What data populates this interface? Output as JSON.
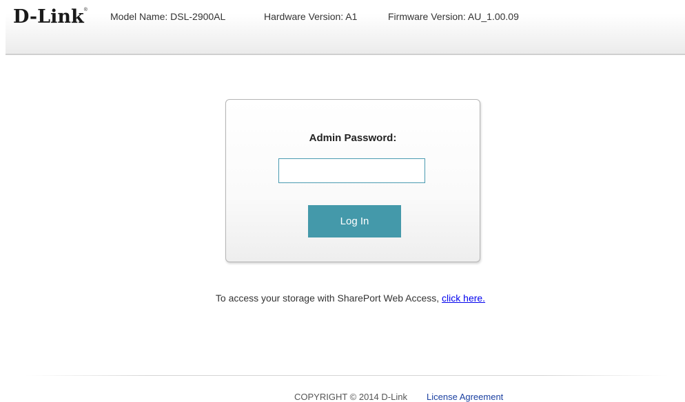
{
  "header": {
    "logo_text": "D-Link",
    "logo_mark": "®",
    "model_name": "Model Name: DSL-2900AL",
    "hardware_version": "Hardware Version: A1",
    "firmware_version": "Firmware Version: AU_1.00.09"
  },
  "login": {
    "label": "Admin Password:",
    "password_value": "",
    "button_label": "Log In",
    "button_color": "#4499aa"
  },
  "sharepoint": {
    "text": "To access your storage with SharePort Web Access, ",
    "link_text": "click here."
  },
  "footer": {
    "copyright": "COPYRIGHT © 2014 D-Link",
    "license_link": "License Agreement"
  }
}
